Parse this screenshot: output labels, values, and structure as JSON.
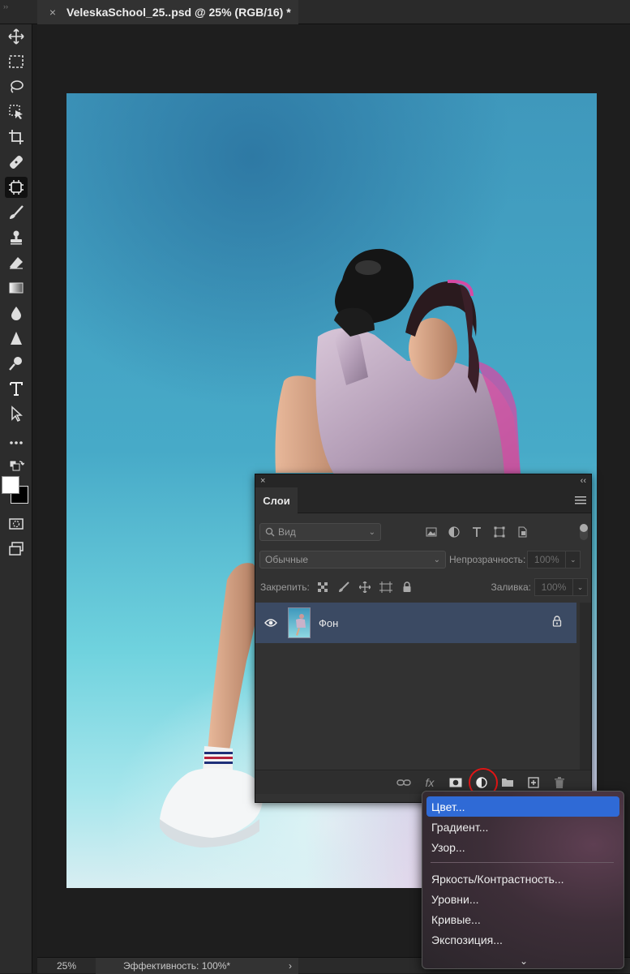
{
  "document_tab": {
    "close_glyph": "×",
    "title": "VeleskaSchool_25..psd @ 25% (RGB/16) *"
  },
  "colors": {
    "accent_selected": "#2f6ad6",
    "layer_selected": "#3b4a63",
    "annotation_red": "#e01515"
  },
  "toolbar": {
    "tools": [
      "move-icon",
      "marquee-icon",
      "lasso-icon",
      "object-select-icon",
      "crop-icon",
      "healing-icon",
      "generative-fill-icon",
      "brush-icon",
      "stamp-icon",
      "eraser-icon",
      "gradient-icon",
      "blur-drop-icon",
      "sharpen-icon",
      "dodge-icon",
      "type-icon",
      "path-select-icon",
      "more-icon"
    ],
    "active_tool": "generative-fill-icon"
  },
  "layers_panel": {
    "collapse_glyph": "‹‹",
    "close_glyph": "×",
    "tab_label": "Слои",
    "filter_placeholder": "Вид",
    "blend_mode": "Обычные",
    "opacity_label": "Непрозрачность:",
    "opacity_value": "100%",
    "lock_label": "Закрепить:",
    "fill_label": "Заливка:",
    "fill_value": "100%",
    "layers": [
      {
        "name": "Фон",
        "visible": true,
        "locked": true
      }
    ],
    "bottom_fx_label": "fx"
  },
  "adjustment_menu": {
    "items_group1": [
      "Цвет...",
      "Градиент...",
      "Узор..."
    ],
    "items_group2": [
      "Яркость/Контрастность...",
      "Уровни...",
      "Кривые...",
      "Экспозиция..."
    ],
    "selected_item": "Цвет...",
    "more_glyph": "⌄"
  },
  "status_bar": {
    "zoom": "25%",
    "efficiency": "Эффективность: 100%*",
    "arrow": "›"
  }
}
